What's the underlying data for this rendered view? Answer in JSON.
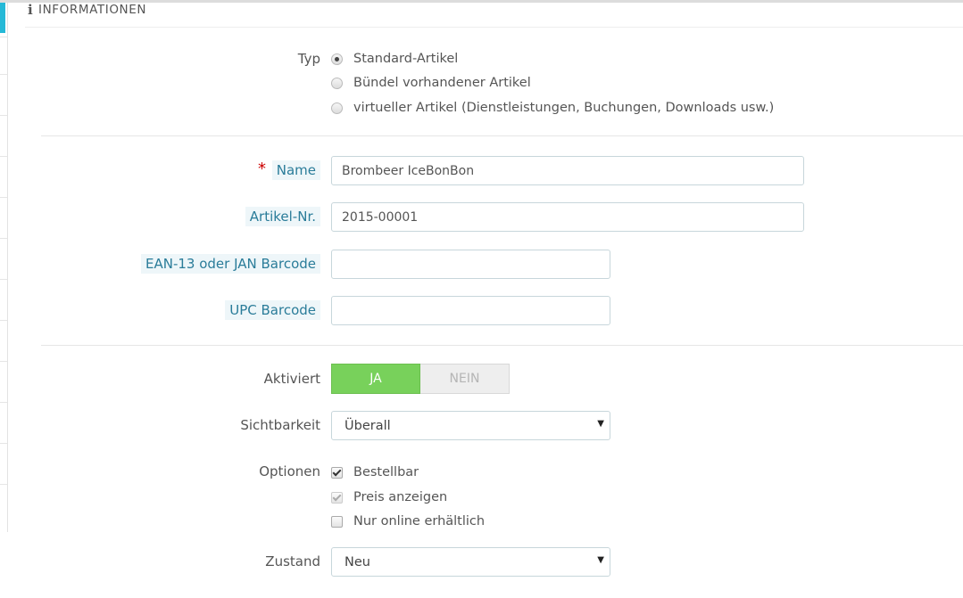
{
  "panel": {
    "icon": "info-icon",
    "title": "INFORMATIONEN"
  },
  "typ": {
    "label": "Typ",
    "options": [
      {
        "label": "Standard-Artikel",
        "selected": true
      },
      {
        "label": "Bündel vorhandener Artikel",
        "selected": false
      },
      {
        "label": "virtueller Artikel (Dienstleistungen, Buchungen, Downloads usw.)",
        "selected": false
      }
    ]
  },
  "name": {
    "required_mark": "*",
    "label": "Name",
    "value": "Brombeer IceBonBon"
  },
  "reference": {
    "label": "Artikel-Nr.",
    "value": "2015-00001"
  },
  "ean13": {
    "label": "EAN-13 oder JAN Barcode",
    "value": ""
  },
  "upc": {
    "label": "UPC Barcode",
    "value": ""
  },
  "active": {
    "label": "Aktiviert",
    "yes": "JA",
    "no": "NEIN",
    "selected": "JA",
    "accent": "#78d15b"
  },
  "visibility": {
    "label": "Sichtbarkeit",
    "value": "Überall",
    "arrow": "▼"
  },
  "options": {
    "label": "Optionen",
    "items": [
      {
        "label": "Bestellbar",
        "checked": true,
        "disabled": false
      },
      {
        "label": "Preis anzeigen",
        "checked": true,
        "disabled": true
      },
      {
        "label": "Nur online erhältlich",
        "checked": false,
        "disabled": false
      }
    ]
  },
  "condition": {
    "label": "Zustand",
    "value": "Neu",
    "arrow": "▼"
  },
  "colors": {
    "help_label_bg": "#eef6f9",
    "help_label_text": "#2a7c99",
    "required": "#cc0000",
    "left_accent": "#25b9d7"
  }
}
